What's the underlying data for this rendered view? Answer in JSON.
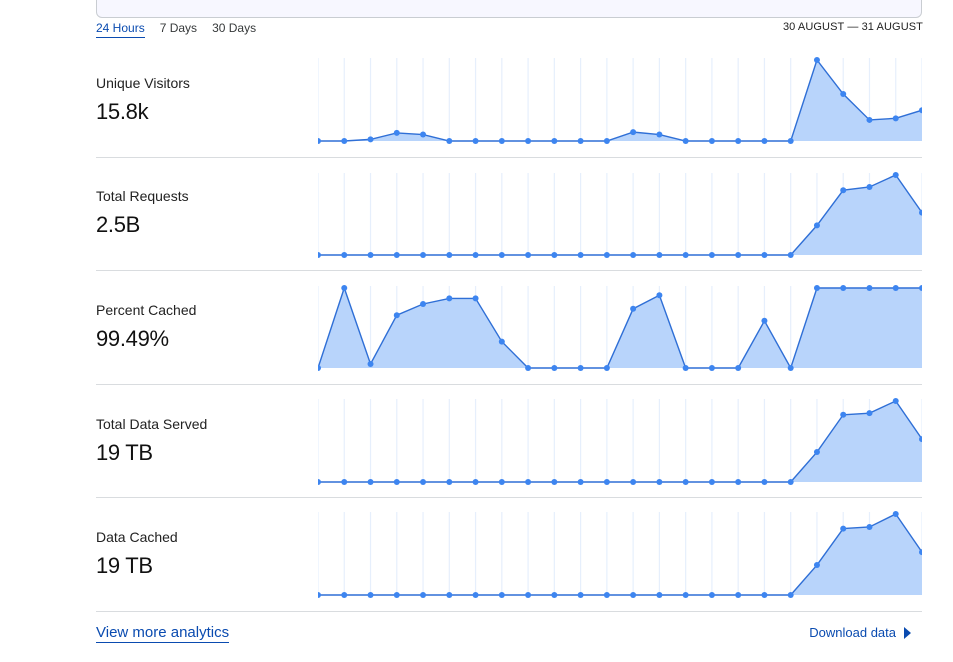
{
  "range_tabs": [
    {
      "label": "24 Hours",
      "active": true
    },
    {
      "label": "7 Days",
      "active": false
    },
    {
      "label": "30 Days",
      "active": false
    }
  ],
  "date_range": "30 AUGUST — 31 AUGUST",
  "colors": {
    "accent": "#0a4bb0",
    "line": "#2f6fd6",
    "fill": "#b8d4fb",
    "point": "#3d85f0",
    "grid": "#e6effc"
  },
  "metrics": [
    {
      "label": "Unique Visitors",
      "value": "15.8k"
    },
    {
      "label": "Total Requests",
      "value": "2.5B"
    },
    {
      "label": "Percent Cached",
      "value": "99.49%"
    },
    {
      "label": "Total Data Served",
      "value": "19 TB"
    },
    {
      "label": "Data Cached",
      "value": "19 TB"
    }
  ],
  "chart_data": [
    {
      "type": "area",
      "title": "",
      "x": [
        1,
        2,
        3,
        4,
        5,
        6,
        7,
        8,
        9,
        10,
        11,
        12,
        13,
        14,
        15,
        16,
        17,
        18,
        19,
        20,
        21,
        22,
        23,
        24
      ],
      "ylim": [
        0,
        1
      ],
      "series": [
        {
          "values": [
            0,
            0,
            0.02,
            0.1,
            0.08,
            0,
            0,
            0,
            0,
            0,
            0,
            0,
            0.11,
            0.08,
            0,
            0,
            0,
            0,
            0,
            1,
            0.58,
            0.26,
            0.28,
            0.38
          ]
        }
      ]
    },
    {
      "type": "area",
      "title": "",
      "x": [
        1,
        2,
        3,
        4,
        5,
        6,
        7,
        8,
        9,
        10,
        11,
        12,
        13,
        14,
        15,
        16,
        17,
        18,
        19,
        20,
        21,
        22,
        23,
        24
      ],
      "ylim": [
        0,
        1
      ],
      "series": [
        {
          "values": [
            0,
            0,
            0,
            0,
            0,
            0,
            0,
            0,
            0,
            0,
            0,
            0,
            0,
            0,
            0,
            0,
            0,
            0,
            0,
            0.37,
            0.81,
            0.85,
            1,
            0.53
          ]
        }
      ]
    },
    {
      "type": "area",
      "title": "",
      "x": [
        1,
        2,
        3,
        4,
        5,
        6,
        7,
        8,
        9,
        10,
        11,
        12,
        13,
        14,
        15,
        16,
        17,
        18,
        19,
        20,
        21,
        22,
        23,
        24
      ],
      "ylim": [
        0,
        1
      ],
      "series": [
        {
          "values": [
            0,
            1,
            0.05,
            0.66,
            0.8,
            0.87,
            0.87,
            0.33,
            0,
            0,
            0,
            0,
            0.74,
            0.91,
            0,
            0,
            0,
            0.59,
            0,
            1,
            1,
            1,
            1,
            1
          ]
        }
      ]
    },
    {
      "type": "area",
      "title": "",
      "x": [
        1,
        2,
        3,
        4,
        5,
        6,
        7,
        8,
        9,
        10,
        11,
        12,
        13,
        14,
        15,
        16,
        17,
        18,
        19,
        20,
        21,
        22,
        23,
        24
      ],
      "ylim": [
        0,
        1
      ],
      "series": [
        {
          "values": [
            0,
            0,
            0,
            0,
            0,
            0,
            0,
            0,
            0,
            0,
            0,
            0,
            0,
            0,
            0,
            0,
            0,
            0,
            0,
            0.37,
            0.83,
            0.85,
            1,
            0.53
          ]
        }
      ]
    },
    {
      "type": "area",
      "title": "",
      "x": [
        1,
        2,
        3,
        4,
        5,
        6,
        7,
        8,
        9,
        10,
        11,
        12,
        13,
        14,
        15,
        16,
        17,
        18,
        19,
        20,
        21,
        22,
        23,
        24
      ],
      "ylim": [
        0,
        1
      ],
      "series": [
        {
          "values": [
            0,
            0,
            0,
            0,
            0,
            0,
            0,
            0,
            0,
            0,
            0,
            0,
            0,
            0,
            0,
            0,
            0,
            0,
            0,
            0.37,
            0.82,
            0.84,
            1,
            0.53
          ]
        }
      ]
    }
  ],
  "footer": {
    "more_link": "View more analytics",
    "download": "Download data"
  }
}
